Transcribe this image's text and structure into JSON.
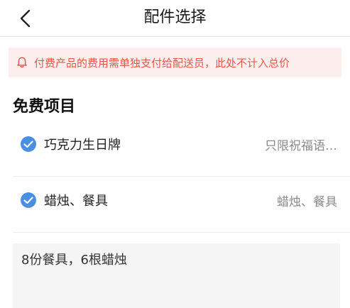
{
  "header": {
    "title": "配件选择",
    "back_icon": "chevron-left-icon"
  },
  "notice": {
    "icon": "bell-icon",
    "text": "付费产品的费用需单独支付给配送员，此处不计入总价",
    "color": "#e4584a",
    "background": "#fbeeec"
  },
  "free_section": {
    "title": "免费项目",
    "items": [
      {
        "label": "巧克力生日牌",
        "value": "只限祝福语…",
        "checked": true
      },
      {
        "label": "蜡烛、餐具",
        "value": "蜡烛、餐具",
        "checked": true
      }
    ]
  },
  "note": {
    "text": "8份餐具，6根蜡烛"
  },
  "colors": {
    "accent": "#4a90e2",
    "check_fill": "#4a90e2"
  }
}
